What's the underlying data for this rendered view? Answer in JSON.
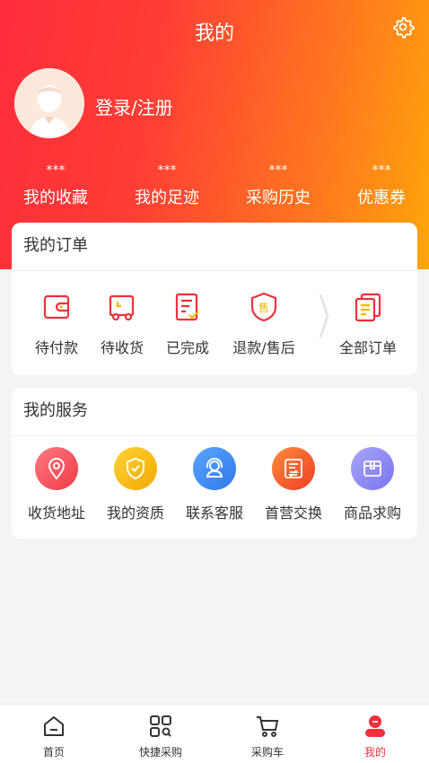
{
  "header": {
    "title": "我的",
    "login_text": "登录/注册"
  },
  "stats": [
    {
      "value": "***",
      "label": "我的收藏"
    },
    {
      "value": "***",
      "label": "我的足迹"
    },
    {
      "value": "***",
      "label": "采购历史"
    },
    {
      "value": "***",
      "label": "优惠券"
    }
  ],
  "orders": {
    "title": "我的订单",
    "items": [
      {
        "label": "待付款",
        "icon": "wallet-icon"
      },
      {
        "label": "待收货",
        "icon": "truck-icon"
      },
      {
        "label": "已完成",
        "icon": "completed-doc-icon"
      },
      {
        "label": "退款/售后",
        "icon": "after-sales-shield-icon"
      },
      {
        "label": "全部订单",
        "icon": "all-orders-icon"
      }
    ]
  },
  "services": {
    "title": "我的服务",
    "items": [
      {
        "label": "收货地址",
        "icon": "location-pin-icon",
        "color": "#f0474f"
      },
      {
        "label": "我的资质",
        "icon": "shield-check-icon",
        "color": "#f7b800"
      },
      {
        "label": "联系客服",
        "icon": "headset-icon",
        "color": "#3b8cf5"
      },
      {
        "label": "首营交换",
        "icon": "exchange-doc-icon",
        "color": "#f45a2c"
      },
      {
        "label": "商品求购",
        "icon": "box-icon",
        "color": "#8a86f2"
      }
    ]
  },
  "tabbar": [
    {
      "label": "首页",
      "icon": "home-icon"
    },
    {
      "label": "快捷采购",
      "icon": "quick-purchase-icon"
    },
    {
      "label": "采购车",
      "icon": "cart-icon"
    },
    {
      "label": "我的",
      "icon": "profile-icon",
      "active": true
    }
  ],
  "colors": {
    "accent": "#f0303a",
    "gradient_start": "#ff2d3c",
    "gradient_end": "#ffa60a"
  }
}
